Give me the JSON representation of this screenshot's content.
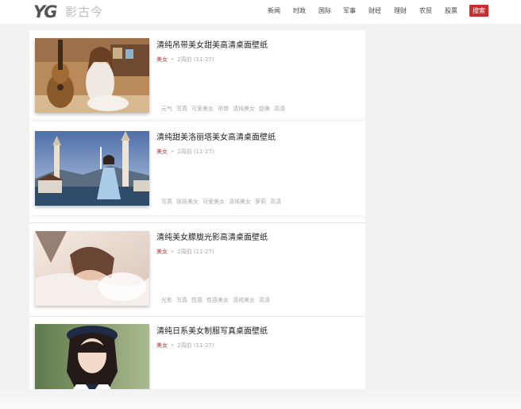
{
  "logo": {
    "mark_a": "YG",
    "text": "影古今"
  },
  "nav": {
    "items": [
      "新闻",
      "时政",
      "国际",
      "军事",
      "财经",
      "理财",
      "农贸",
      "股票"
    ],
    "search_label": "搜索"
  },
  "articles": [
    {
      "title": "清纯吊带美女甜美高清桌面壁纸",
      "category": "美女",
      "time": "2周前 (11-27)",
      "tags": [
        "元气",
        "写真",
        "可爱美女",
        "吊带",
        "清纯美女",
        "甜美",
        "高清"
      ]
    },
    {
      "title": "清纯甜美洛丽塔美女高清桌面壁纸",
      "category": "美女",
      "time": "2周前 (11-27)",
      "tags": [
        "写真",
        "娃娃美女",
        "可爱美女",
        "清纯美女",
        "萝莉",
        "高清"
      ]
    },
    {
      "title": "清纯美女朦胧光影高清桌面壁纸",
      "category": "美女",
      "time": "2周前 (11-27)",
      "tags": [
        "光影",
        "写真",
        "性感",
        "性感美女",
        "清纯美女",
        "高清"
      ]
    },
    {
      "title": "清纯日系美女制服写真桌面壁纸",
      "category": "美女",
      "time": "2周前 (11-27)",
      "tags": []
    }
  ]
}
